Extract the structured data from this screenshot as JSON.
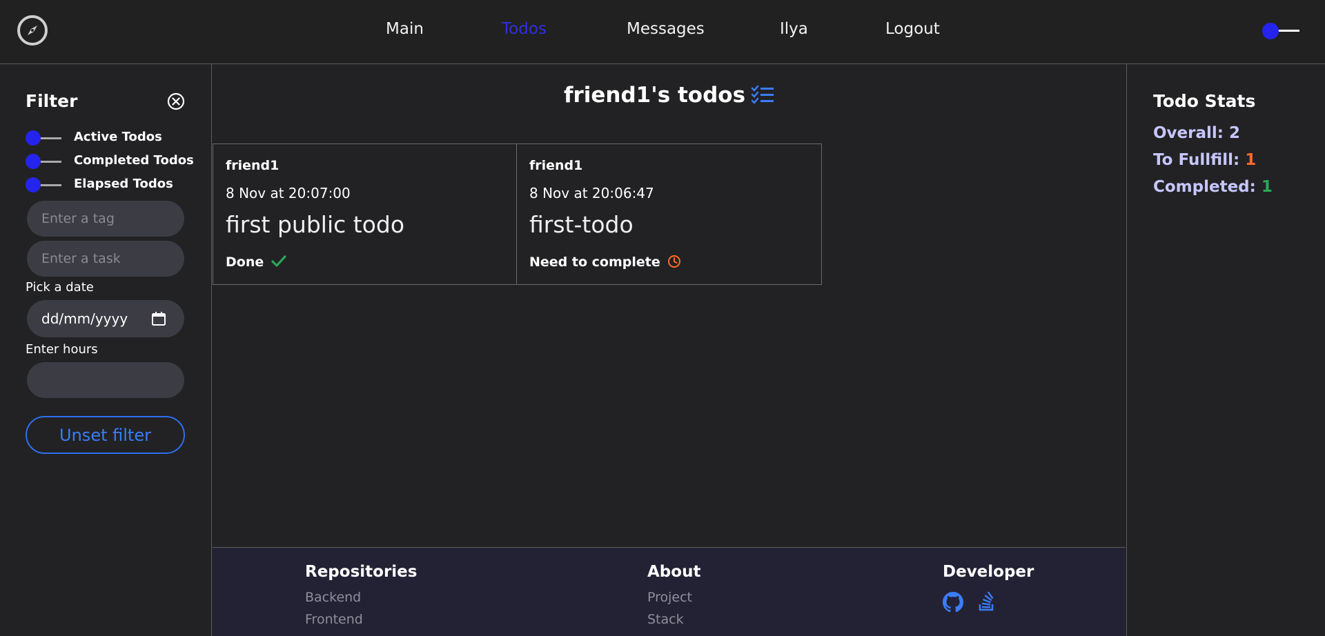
{
  "nav": {
    "items": [
      "Main",
      "Todos",
      "Messages",
      "Ilya",
      "Logout"
    ],
    "active": "Todos"
  },
  "filter": {
    "title": "Filter",
    "toggles": [
      "Active Todos",
      "Completed Todos",
      "Elapsed Todos"
    ],
    "tag_placeholder": "Enter a tag",
    "task_placeholder": "Enter a task",
    "date_label": "Pick a date",
    "date_value": "dd/mm/yyyy",
    "hours_label": "Enter hours",
    "hours_value": "",
    "unset_label": "Unset filter"
  },
  "main": {
    "title": "friend1's todos",
    "cards": [
      {
        "author": "friend1",
        "time": "8 Nov at 20:07:00",
        "task": "first public todo",
        "status": "Done",
        "status_icon": "check-icon"
      },
      {
        "author": "friend1",
        "time": "8 Nov at 20:06:47",
        "task": "first-todo",
        "status": "Need to complete",
        "status_icon": "clock-icon"
      }
    ]
  },
  "stats": {
    "title": "Todo Stats",
    "overall_label": "Overall:",
    "overall": "2",
    "fulfill_label": "To Fullfill:",
    "fulfill": "1",
    "completed_label": "Completed:",
    "completed": "1"
  },
  "footer": {
    "repos_title": "Repositories",
    "repos": [
      "Backend",
      "Frontend"
    ],
    "about_title": "About",
    "about": [
      "Project",
      "Stack"
    ],
    "dev_title": "Developer",
    "dev_icons": [
      "github-icon",
      "stackoverflow-icon"
    ]
  },
  "colors": {
    "accent_blue": "#2424ee",
    "link_blue": "#3b7df7",
    "orange": "#ff6a2b",
    "green": "#2aa857"
  }
}
